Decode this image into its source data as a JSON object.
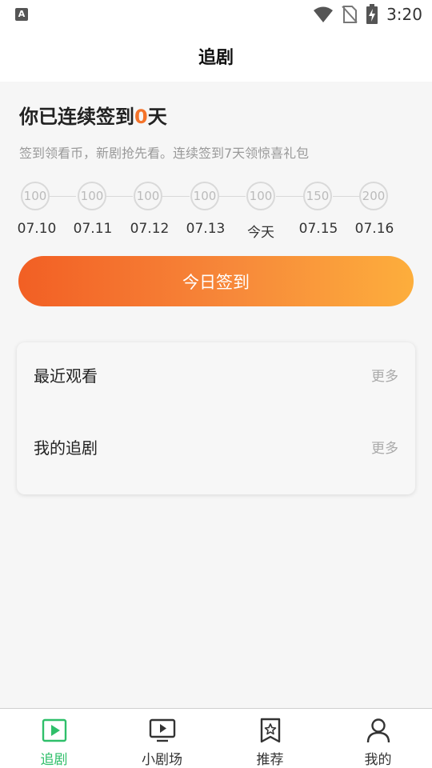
{
  "status_bar": {
    "left_icon_glyph": "A",
    "time": "3:20",
    "icons": [
      "wifi-icon",
      "no-sim-icon",
      "battery-charging-icon"
    ]
  },
  "header": {
    "title": "追剧"
  },
  "checkin": {
    "title_prefix": "你已连续签到",
    "days_count": "0",
    "title_suffix": "天",
    "subtitle": "签到领看币，新剧抢先看。连续签到7天领惊喜礼包",
    "days": [
      {
        "reward": "100",
        "label": "07.10"
      },
      {
        "reward": "100",
        "label": "07.11"
      },
      {
        "reward": "100",
        "label": "07.12"
      },
      {
        "reward": "100",
        "label": "07.13"
      },
      {
        "reward": "100",
        "label": "今天"
      },
      {
        "reward": "150",
        "label": "07.15"
      },
      {
        "reward": "200",
        "label": "07.16"
      }
    ],
    "button_label": "今日签到",
    "accent_color": "#f4732a"
  },
  "lists": {
    "recent": {
      "label": "最近观看",
      "more": "更多"
    },
    "following": {
      "label": "我的追剧",
      "more": "更多"
    }
  },
  "tabs": [
    {
      "label": "追剧",
      "icon": "play-square-icon",
      "active": true
    },
    {
      "label": "小剧场",
      "icon": "tv-play-icon",
      "active": false
    },
    {
      "label": "推荐",
      "icon": "bookmark-star-icon",
      "active": false
    },
    {
      "label": "我的",
      "icon": "user-icon",
      "active": false
    }
  ],
  "colors": {
    "active_tab": "#2fbf6a",
    "button_gradient_start": "#f25f24",
    "button_gradient_end": "#fdae3c"
  }
}
